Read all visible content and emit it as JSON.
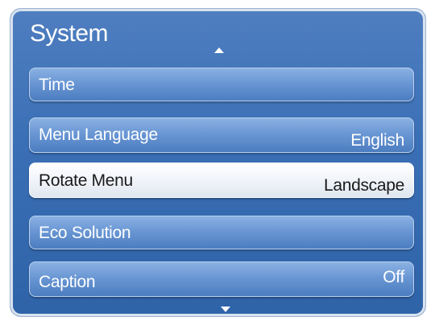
{
  "menu": {
    "title": "System",
    "items": [
      {
        "label": "Time",
        "value": ""
      },
      {
        "label": "Menu Language",
        "value": "English"
      },
      {
        "label": "Rotate Menu",
        "value": "Landscape",
        "selected": true
      },
      {
        "label": "Eco Solution",
        "value": ""
      },
      {
        "label": "Caption",
        "value": "Off"
      }
    ]
  },
  "colors": {
    "panel": "#3a6fb5",
    "item": "#6a97d4",
    "selected_item": "#eef2f8",
    "text": "#ffffff",
    "selected_text": "#1a1a1a"
  },
  "icons": {
    "scroll_up": "triangle-up",
    "scroll_down": "triangle-down"
  }
}
